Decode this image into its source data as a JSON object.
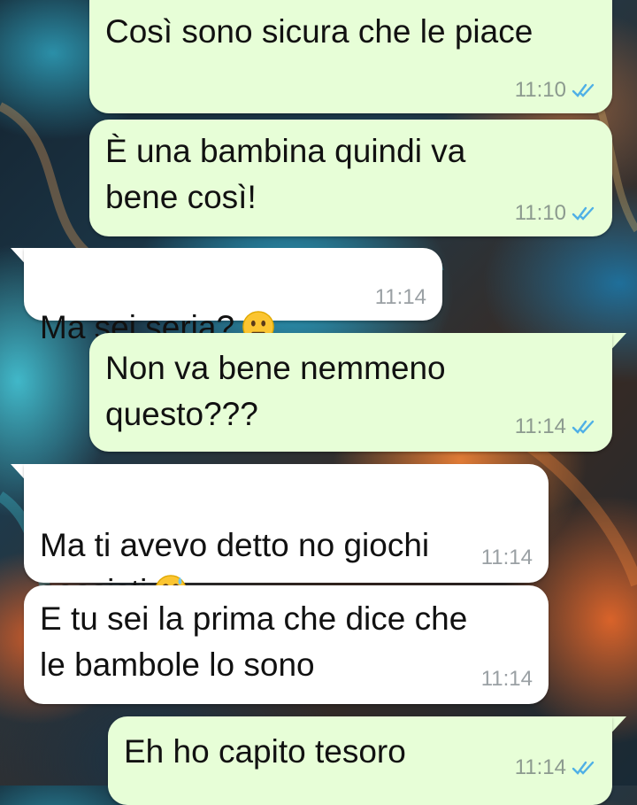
{
  "colors": {
    "outgoing_bubble": "#e7fed7",
    "incoming_bubble": "#ffffff",
    "read_ticks": "#4fb0e6",
    "timestamp": "#8c9a8f"
  },
  "messages": [
    {
      "direction": "outgoing",
      "text": "Così sono sicura che le piace",
      "time": "11:10",
      "status": "read"
    },
    {
      "direction": "outgoing",
      "text": "È una bambina quindi va\nbene così!",
      "time": "11:10",
      "status": "read"
    },
    {
      "direction": "incoming",
      "text": "Ma sei seria?",
      "emoji": "neutral-face",
      "time": "11:14"
    },
    {
      "direction": "outgoing",
      "text": "Non va bene nemmeno\nquesto???",
      "time": "11:14",
      "status": "read"
    },
    {
      "direction": "incoming",
      "text": "Ma ti avevo detto no giochi\nsessisti",
      "emoji": "grinning-sweat-face",
      "time": "11:14"
    },
    {
      "direction": "incoming",
      "text": "E tu sei la prima che dice che\nle bambole lo sono",
      "time": "11:14"
    },
    {
      "direction": "outgoing",
      "text": "Eh ho capito tesoro",
      "time": "11:14",
      "status": "read"
    }
  ]
}
